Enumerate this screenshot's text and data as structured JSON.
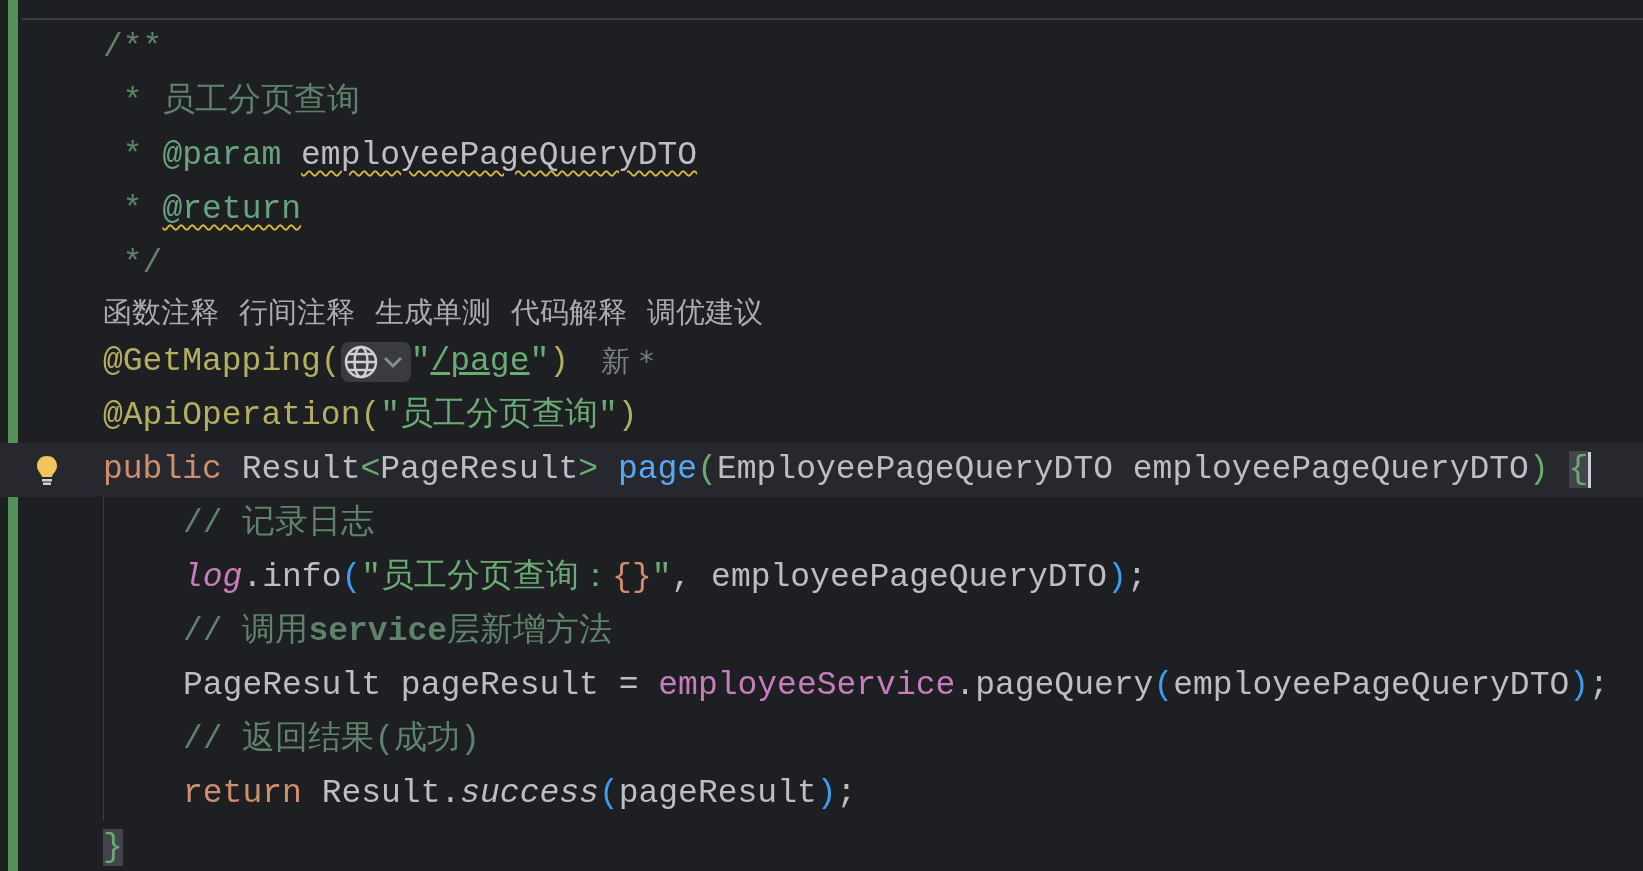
{
  "editor": {
    "lines": [
      {
        "kind": "code",
        "current": false,
        "tokens": [
          {
            "text": "/**",
            "kind": "doc"
          }
        ]
      },
      {
        "kind": "code",
        "current": false,
        "tokens": [
          {
            "text": " * 员工分页查询",
            "kind": "doc"
          }
        ]
      },
      {
        "kind": "code",
        "current": false,
        "tokens": [
          {
            "text": " * ",
            "kind": "doc"
          },
          {
            "text": "@param ",
            "kind": "doctag",
            "warning": false
          },
          {
            "text": "employeePageQueryDTO",
            "kind": "docref",
            "warning": true
          }
        ]
      },
      {
        "kind": "code",
        "current": false,
        "tokens": [
          {
            "text": " * ",
            "kind": "doc"
          },
          {
            "text": "@return",
            "kind": "doctag",
            "warning": true
          }
        ]
      },
      {
        "kind": "code",
        "current": false,
        "tokens": [
          {
            "text": " */",
            "kind": "doc"
          }
        ]
      },
      {
        "kind": "hints",
        "links": [
          "函数注释",
          "行间注释",
          "生成单测",
          "代码解释",
          "调优建议"
        ]
      },
      {
        "kind": "code",
        "current": false,
        "inlay": "新 *",
        "tokens": [
          {
            "text": "@GetMapping(",
            "kind": "annotation"
          },
          {
            "kind": "url-icon"
          },
          {
            "text": "\"",
            "kind": "string"
          },
          {
            "text": "/page",
            "kind": "url"
          },
          {
            "text": "\"",
            "kind": "string"
          },
          {
            "text": ")",
            "kind": "annotation"
          }
        ]
      },
      {
        "kind": "code",
        "current": false,
        "tokens": [
          {
            "text": "@ApiOperation(",
            "kind": "annotation"
          },
          {
            "text": "\"员工分页查询\"",
            "kind": "string"
          },
          {
            "text": ")",
            "kind": "annotation"
          }
        ]
      },
      {
        "kind": "code",
        "current": true,
        "tokens": [
          {
            "text": "public",
            "kind": "keyword"
          },
          {
            "text": " Result",
            "kind": "plain"
          },
          {
            "text": "<",
            "kind": "paren-green"
          },
          {
            "text": "PageResult",
            "kind": "plain"
          },
          {
            "text": "> ",
            "kind": "paren-green"
          },
          {
            "text": "page",
            "kind": "method"
          },
          {
            "text": "(",
            "kind": "paren-green"
          },
          {
            "text": "EmployeePageQueryDTO employeePageQueryDTO",
            "kind": "plain"
          },
          {
            "text": ") ",
            "kind": "paren-green"
          },
          {
            "text": "{",
            "kind": "brace-match"
          }
        ],
        "children": [
          {
            "kind": "code",
            "current": false,
            "tokens": [
              {
                "text": "// 记录日志",
                "kind": "comment"
              }
            ]
          },
          {
            "kind": "code",
            "current": false,
            "tokens": [
              {
                "text": "log",
                "kind": "static"
              },
              {
                "text": ".info",
                "kind": "plain"
              },
              {
                "text": "(",
                "kind": "paren-blue"
              },
              {
                "text": "\"员工分页查询：",
                "kind": "string"
              },
              {
                "text": "{}",
                "kind": "placeholder"
              },
              {
                "text": "\"",
                "kind": "string"
              },
              {
                "text": ", employeePageQueryDTO",
                "kind": "plain"
              },
              {
                "text": ")",
                "kind": "paren-blue"
              },
              {
                "text": ";",
                "kind": "plain"
              }
            ]
          },
          {
            "kind": "code",
            "current": false,
            "tokens": [
              {
                "text": "// 调用",
                "kind": "comment"
              },
              {
                "text": "service",
                "kind": "comment-bold"
              },
              {
                "text": "层新增方法",
                "kind": "comment"
              }
            ]
          },
          {
            "kind": "code",
            "current": false,
            "tokens": [
              {
                "text": "PageResult pageResult = ",
                "kind": "plain"
              },
              {
                "text": "employeeService",
                "kind": "field"
              },
              {
                "text": ".pageQuery",
                "kind": "plain"
              },
              {
                "text": "(",
                "kind": "paren-blue"
              },
              {
                "text": "employeePageQueryDTO",
                "kind": "plain"
              },
              {
                "text": ")",
                "kind": "paren-blue"
              },
              {
                "text": ";",
                "kind": "plain"
              }
            ]
          },
          {
            "kind": "code",
            "current": false,
            "tokens": [
              {
                "text": "// 返回结果(成功)",
                "kind": "comment"
              }
            ]
          },
          {
            "kind": "code",
            "current": false,
            "tokens": [
              {
                "text": "return",
                "kind": "keyword"
              },
              {
                "text": " Result.",
                "kind": "plain"
              },
              {
                "text": "success",
                "kind": "italic"
              },
              {
                "text": "(",
                "kind": "paren-blue"
              },
              {
                "text": "pageResult",
                "kind": "plain"
              },
              {
                "text": ")",
                "kind": "paren-blue"
              },
              {
                "text": ";",
                "kind": "plain"
              }
            ]
          }
        ]
      },
      {
        "kind": "code",
        "current": false,
        "tokens": [
          {
            "text": "}",
            "kind": "brace-match"
          }
        ]
      }
    ]
  }
}
